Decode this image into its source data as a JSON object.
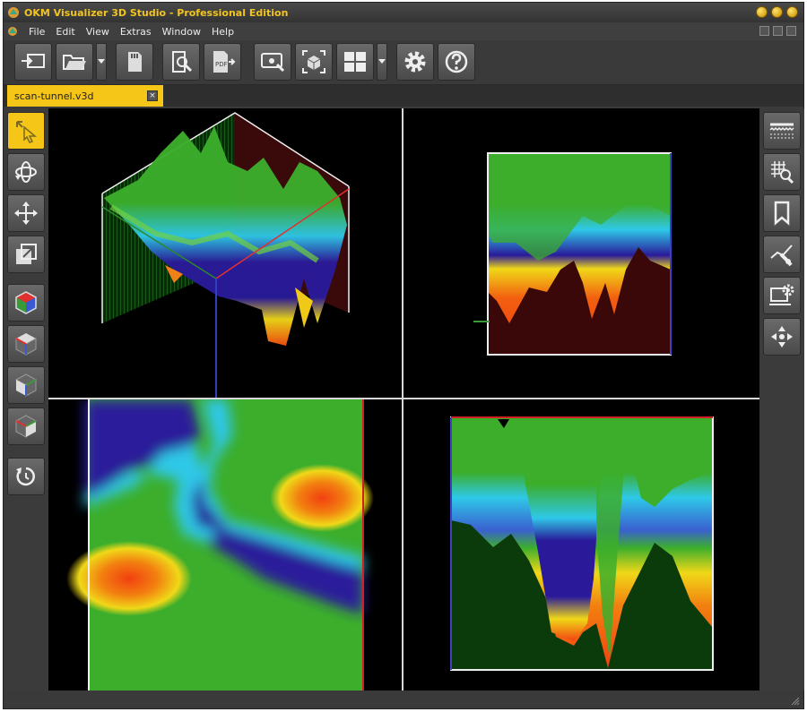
{
  "window": {
    "title": "OKM Visualizer 3D Studio - Professional Edition"
  },
  "menu": {
    "items": [
      "File",
      "Edit",
      "View",
      "Extras",
      "Window",
      "Help"
    ]
  },
  "toolbar": {
    "buttons": [
      "import-icon",
      "open-folder-icon",
      "sd-card-icon",
      "zoom-document-icon",
      "pdf-export-icon",
      "screenshot-icon",
      "fit-3d-icon",
      "layout-grid-icon",
      "settings-gear-icon",
      "help-icon"
    ]
  },
  "tabs": [
    {
      "label": "scan-tunnel.v3d",
      "close": "×",
      "active": true
    }
  ],
  "left_tools": [
    "select",
    "rotate",
    "move",
    "scale",
    "view-3d",
    "view-top",
    "view-front",
    "view-side",
    "reset-view"
  ],
  "right_tools": [
    "surface",
    "grid-zoom",
    "bookmark",
    "measure",
    "monitor-settings",
    "pan"
  ],
  "colors": {
    "accent": "#f5c518",
    "title": "#f2c421",
    "viewport_bg": "#000000"
  }
}
